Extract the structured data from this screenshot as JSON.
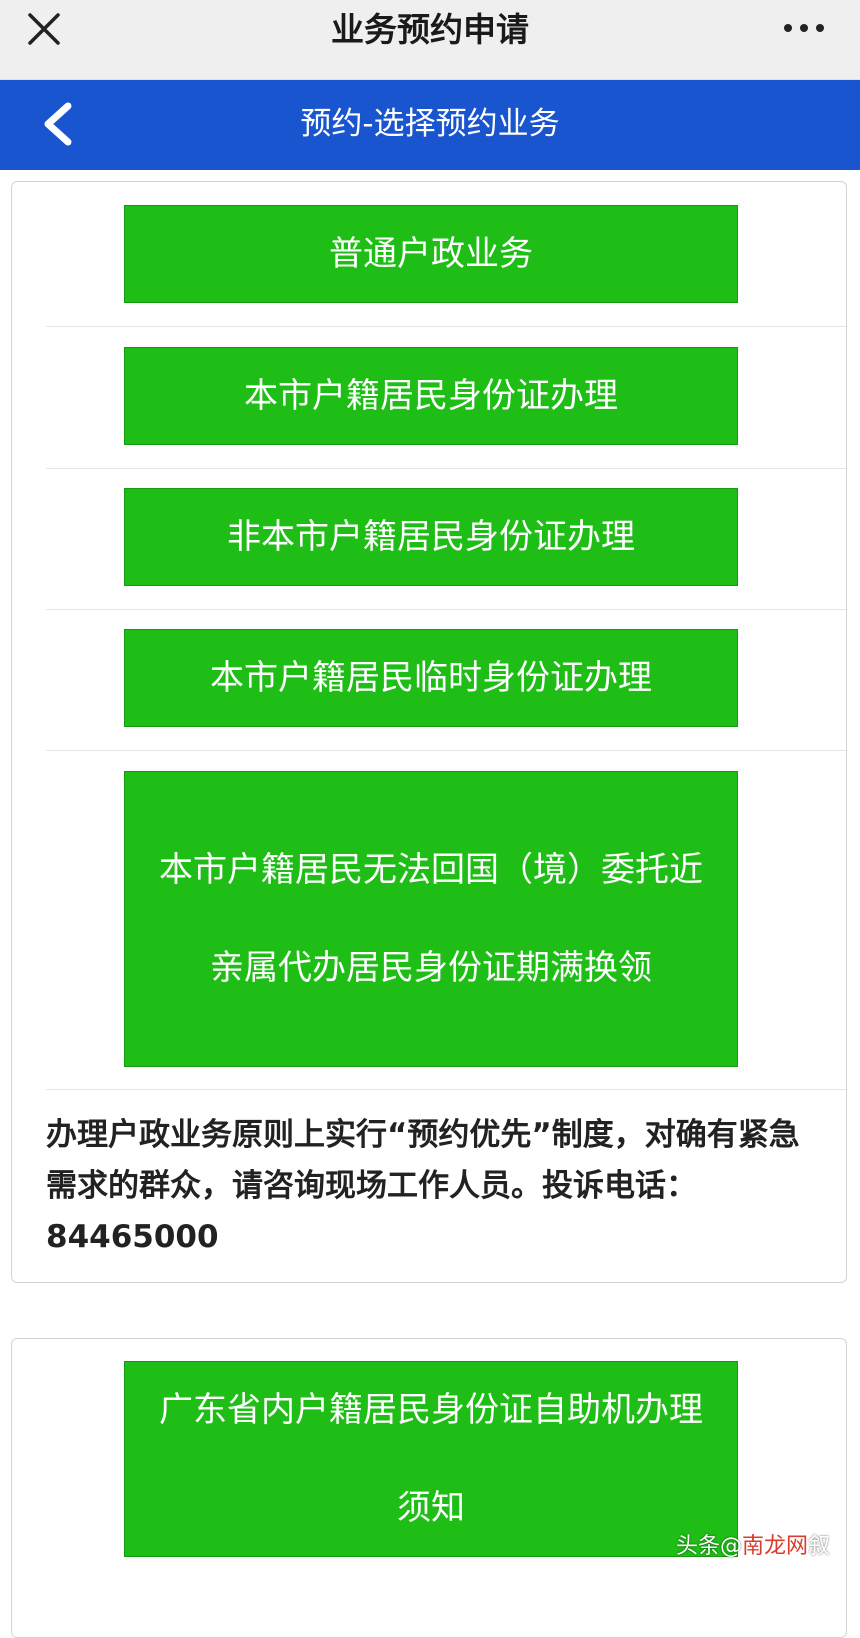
{
  "topbar": {
    "title": "业务预约申请",
    "close_icon": "close-icon",
    "more_icon": "more-icon"
  },
  "navbar": {
    "title": "预约-选择预约业务",
    "back_icon": "back-chevron-icon",
    "color": "#1a55d0"
  },
  "services": [
    {
      "label": "普通户政业务"
    },
    {
      "label": "本市户籍居民身份证办理"
    },
    {
      "label": "非本市户籍居民身份证办理"
    },
    {
      "label": "本市户籍居民临时身份证办理"
    },
    {
      "label": "本市户籍居民无法回国（境）委托近亲属代办居民身份证期满换领"
    }
  ],
  "notice": "办理户政业务原则上实行“预约优先”制度，对确有紧急需求的群众，请咨询现场工作人员。投诉电话：84465000",
  "self_service": {
    "label": "广东省内户籍居民身份证自助机办理须知"
  },
  "watermark": {
    "part1": "头条",
    "part2": "@",
    "part3": "南龙网",
    "part4": "叙"
  },
  "colors": {
    "button_green": "#1ebe16",
    "nav_blue": "#1a55d0"
  }
}
